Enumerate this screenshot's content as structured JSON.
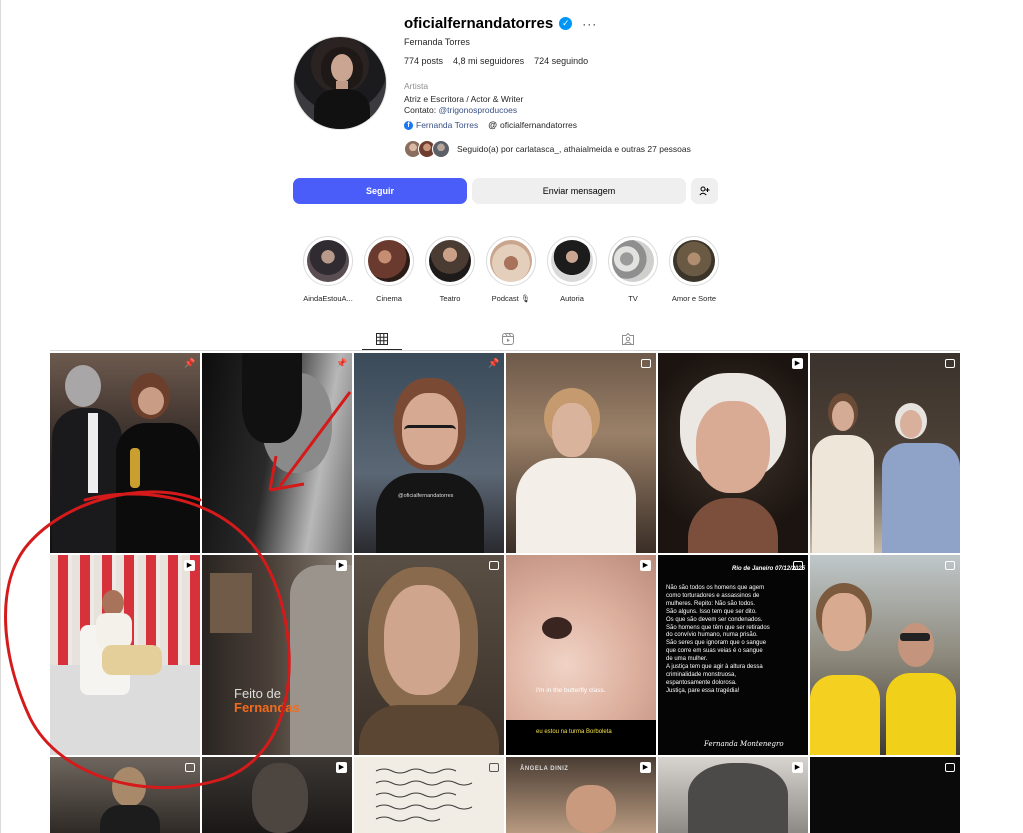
{
  "profile": {
    "username": "oficialfernandatorres",
    "full_name": "Fernanda Torres",
    "stats": {
      "posts": "774 posts",
      "followers": "4,8 mi seguidores",
      "following": "724 seguindo"
    },
    "category": "Artista",
    "bio_line1": "Atriz e Escritora / Actor & Writer",
    "bio_contact_prefix": "Contato: ",
    "bio_contact_link": "@trigonosproducoes",
    "facebook_link": "Fernanda Torres",
    "threads_link": "oficialfernandatorres",
    "followed_by": "Seguido(a) por carlatasca_, athaialmeida e outras 27 pessoas"
  },
  "actions": {
    "follow": "Seguir",
    "message": "Enviar mensagem",
    "suggest_icon": "add-person-icon"
  },
  "highlights": [
    {
      "label": "AindaEstouA...",
      "color": "#5a4e52"
    },
    {
      "label": "Cinema",
      "color": "#6b3a2e"
    },
    {
      "label": "Teatro",
      "color": "#4a3b33"
    },
    {
      "label": "Podcast 🎙",
      "color": "#c9a58e"
    },
    {
      "label": "Autoria",
      "color": "#8d8d8d"
    },
    {
      "label": "TV",
      "color": "#c9c9c7"
    },
    {
      "label": "Amor e Sorte",
      "color": "#6a5a44"
    }
  ],
  "tabs": {
    "posts_icon": "grid-icon",
    "reels_icon": "reels-icon",
    "tagged_icon": "tagged-icon"
  },
  "grid_text": {
    "tile3_caption": "@oficialfernandatorres",
    "tile8_title": "Feito de",
    "tile8_subtitle": "Fernandas",
    "tile10_caption": "I'm in the butterfly class.",
    "tile10_subtitle": "eu estou na turma Borboleta",
    "tile11_date": "Rio de Janeiro 07/12/2025",
    "tile11_body": [
      "Não são todos os homens que agem",
      "como torturadores e assassinos de",
      "mulheres. Repito: Não são todos.",
      "São alguns. Isso tem que ser dito.",
      "Os que são devem ser condenados.",
      "São homens que têm que ser retirados",
      "do convívio humano, numa prisão.",
      "São seres que ignoram que o sangue",
      "que corre em suas veias é o sangue",
      "de uma mulher.",
      "A justiça tem que agir à altura dessa",
      "criminalidade monstruosa,",
      "espantosamente dolorosa.",
      "Justiça, pare essa tragédia!"
    ],
    "tile11_signature": "Fernanda Montenegro",
    "tile16_caption": "ÂNGELA DINIZ"
  }
}
